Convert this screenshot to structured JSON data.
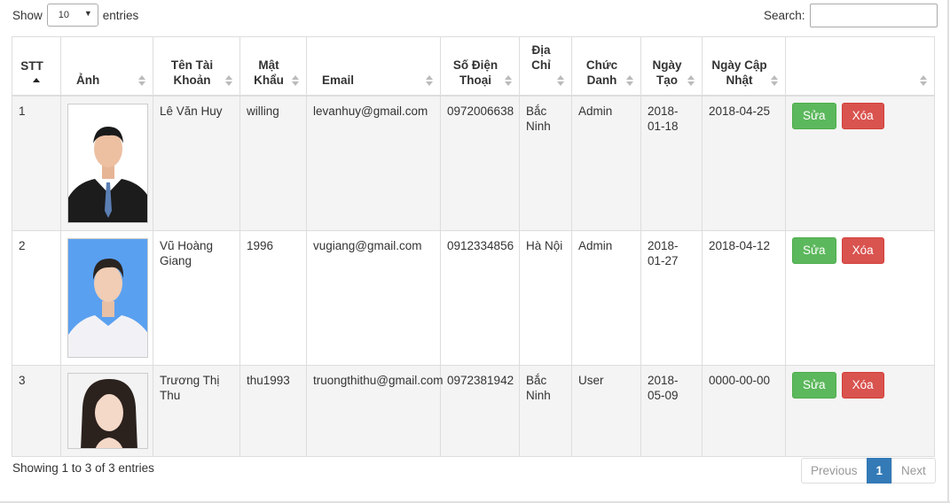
{
  "length_control": {
    "show_label": "Show",
    "value": "10",
    "entries_label": "entries"
  },
  "search": {
    "label": "Search:",
    "value": "",
    "placeholder": ""
  },
  "columns": [
    {
      "key": "stt",
      "label": "STT"
    },
    {
      "key": "photo",
      "label": "Ảnh"
    },
    {
      "key": "username",
      "label": "Tên Tài Khoản"
    },
    {
      "key": "password",
      "label": "Mật Khẩu"
    },
    {
      "key": "email",
      "label": "Email"
    },
    {
      "key": "phone",
      "label": "Số Điện Thoại"
    },
    {
      "key": "address",
      "label": "Địa Chỉ"
    },
    {
      "key": "role",
      "label": "Chức Danh"
    },
    {
      "key": "created",
      "label": "Ngày Tạo"
    },
    {
      "key": "updated",
      "label": "Ngày Cập Nhật"
    },
    {
      "key": "actions",
      "label": ""
    }
  ],
  "rows": [
    {
      "stt": "1",
      "username": "Lê Văn Huy",
      "password": "willing",
      "email": "levanhuy@gmail.com",
      "phone": "0972006638",
      "address": "Bắc Ninh",
      "role": "Admin",
      "created": "2018-01-18",
      "updated": "2018-04-25",
      "edit_label": "Sửa",
      "delete_label": "Xóa"
    },
    {
      "stt": "2",
      "username": "Vũ Hoàng Giang",
      "password": "1996",
      "email": "vugiang@gmail.com",
      "phone": "0912334856",
      "address": "Hà Nội",
      "role": "Admin",
      "created": "2018-01-27",
      "updated": "2018-04-12",
      "edit_label": "Sửa",
      "delete_label": "Xóa"
    },
    {
      "stt": "3",
      "username": "Trương Thị Thu",
      "password": "thu1993",
      "email": "truongthithu@gmail.com",
      "phone": "0972381942",
      "address": "Bắc Ninh",
      "role": "User",
      "created": "2018-05-09",
      "updated": "0000-00-00",
      "edit_label": "Sửa",
      "delete_label": "Xóa"
    }
  ],
  "footer": {
    "info": "Showing 1 to 3 of 3 entries",
    "previous_label": "Previous",
    "current_page": "1",
    "next_label": "Next"
  },
  "colors": {
    "edit": "#5cb85c",
    "delete": "#d9534f",
    "page_active": "#337ab7"
  }
}
